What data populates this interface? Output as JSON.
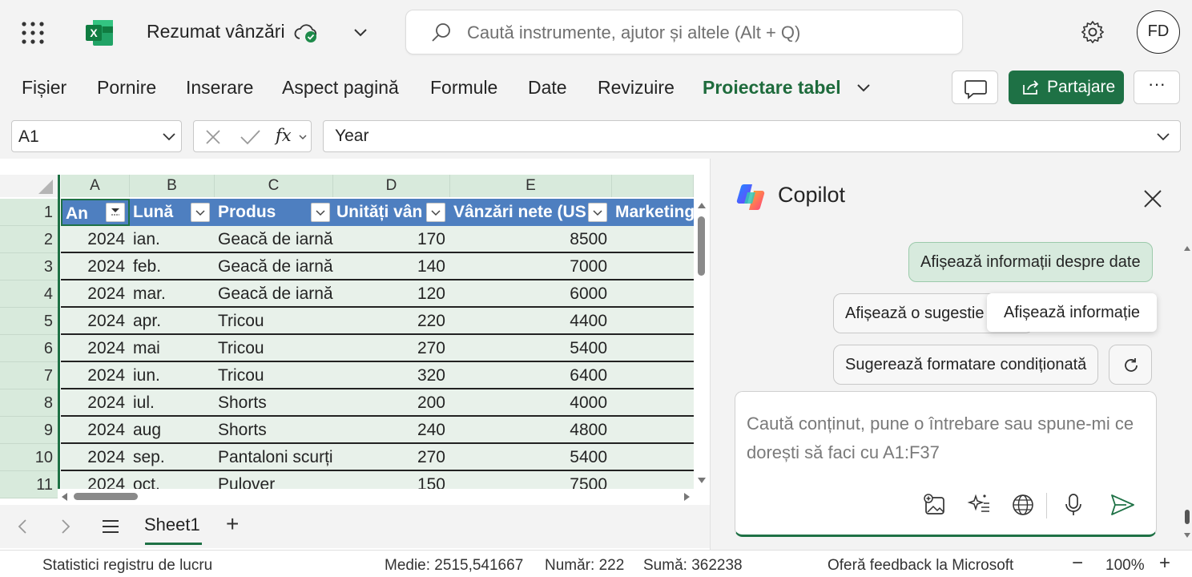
{
  "app": {
    "doc_title": "Rezumat vânzări",
    "search_placeholder": "Caută instrumente, ajutor și altele (Alt + Q)",
    "avatar_initials": "FD",
    "accent_color": "#1e7145",
    "table_header_color": "#4e7fc0"
  },
  "ribbon": {
    "menus": [
      "Fișier",
      "Pornire",
      "Inserare",
      "Aspect pagină",
      "Formule",
      "Date",
      "Revizuire",
      "Proiectare tabel"
    ],
    "active_menu": "Proiectare tabel",
    "share_label": "Partajare",
    "more_label": "···"
  },
  "formula_bar": {
    "name_box": "A1",
    "fx_label": "fx",
    "value": "Year"
  },
  "grid": {
    "columns": [
      "A",
      "B",
      "C",
      "D",
      "E"
    ],
    "row_numbers": [
      "1",
      "2",
      "3",
      "4",
      "5",
      "6",
      "7",
      "8",
      "9",
      "10",
      "11"
    ],
    "headers": [
      "An",
      "Lună",
      "Produs",
      "Unități vân",
      "Vânzări nete (US",
      "Marketing"
    ],
    "rows": [
      [
        "2024",
        "ian.",
        "Geacă de iarnă",
        "170",
        "8500"
      ],
      [
        "2024",
        "feb.",
        "Geacă de iarnă",
        "140",
        "7000"
      ],
      [
        "2024",
        "mar.",
        "Geacă de iarnă",
        "120",
        "6000"
      ],
      [
        "2024",
        "apr.",
        "Tricou",
        "220",
        "4400"
      ],
      [
        "2024",
        "mai",
        "Tricou",
        "270",
        "5400"
      ],
      [
        "2024",
        "iun.",
        "Tricou",
        "320",
        "6400"
      ],
      [
        "2024",
        "iul.",
        "Shorts",
        "200",
        "4000"
      ],
      [
        "2024",
        "aug",
        "Shorts",
        "240",
        "4800"
      ],
      [
        "2024",
        "sep.",
        "Pantaloni scurți",
        "270",
        "5400"
      ],
      [
        "2024",
        "oct.",
        "Pulover",
        "150",
        "7500"
      ]
    ]
  },
  "sheet_tabs": {
    "active": "Sheet1",
    "add_label": "+"
  },
  "status_bar": {
    "workbook_stats": "Statistici registru de lucru",
    "average": "Medie: 2515,541667",
    "count": "Număr: 222",
    "sum": "Sumă: 362238",
    "feedback": "Oferă feedback la Microsoft",
    "zoom": "100%",
    "zoom_out": "−",
    "zoom_in": "+"
  },
  "copilot": {
    "title": "Copilot",
    "suggestions": [
      "Afișează informații despre date",
      "Afișează o sugestie",
      "Sugerează formatare condiționată"
    ],
    "tooltip": "Afișează informație",
    "input_placeholder": "Caută conținut, pune o întrebare sau spune-mi ce dorești să faci cu A1:F37"
  }
}
